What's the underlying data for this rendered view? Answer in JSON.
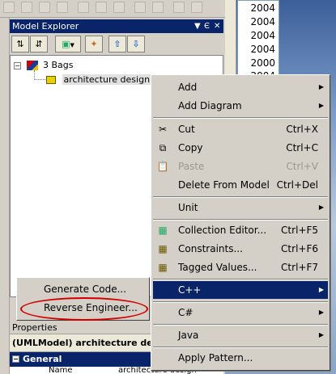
{
  "explorer": {
    "title": "Model Explorer",
    "tree": {
      "root": "3 Bags",
      "child": "architecture design",
      "expand_symbol": "−"
    }
  },
  "years": [
    "2004",
    "2004",
    "2004",
    "2004",
    "2000",
    "2004"
  ],
  "context_menu": {
    "items": [
      {
        "label": "Add",
        "shortcut": "",
        "submenu": true,
        "icon": "",
        "disabled": false,
        "highlighted": false
      },
      {
        "label": "Add Diagram",
        "shortcut": "",
        "submenu": true,
        "icon": "",
        "disabled": false,
        "highlighted": false
      },
      {
        "label": "Cut",
        "shortcut": "Ctrl+X",
        "submenu": false,
        "icon": "scissors-icon",
        "disabled": false,
        "highlighted": false
      },
      {
        "label": "Copy",
        "shortcut": "Ctrl+C",
        "submenu": false,
        "icon": "copy-icon",
        "disabled": false,
        "highlighted": false
      },
      {
        "label": "Paste",
        "shortcut": "Ctrl+V",
        "submenu": false,
        "icon": "paste-icon",
        "disabled": true,
        "highlighted": false
      },
      {
        "label": "Delete From Model",
        "shortcut": "Ctrl+Del",
        "submenu": false,
        "icon": "",
        "disabled": false,
        "highlighted": false
      },
      {
        "label": "Unit",
        "shortcut": "",
        "submenu": true,
        "icon": "",
        "disabled": false,
        "highlighted": false
      },
      {
        "label": "Collection Editor...",
        "shortcut": "Ctrl+F5",
        "submenu": false,
        "icon": "collection-editor-icon",
        "disabled": false,
        "highlighted": false
      },
      {
        "label": "Constraints...",
        "shortcut": "Ctrl+F6",
        "submenu": false,
        "icon": "constraints-icon",
        "disabled": false,
        "highlighted": false
      },
      {
        "label": "Tagged Values...",
        "shortcut": "Ctrl+F7",
        "submenu": false,
        "icon": "tagged-values-icon",
        "disabled": false,
        "highlighted": false
      },
      {
        "label": "C++",
        "shortcut": "",
        "submenu": true,
        "icon": "",
        "disabled": false,
        "highlighted": true
      },
      {
        "label": "C#",
        "shortcut": "",
        "submenu": true,
        "icon": "",
        "disabled": false,
        "highlighted": false
      },
      {
        "label": "Java",
        "shortcut": "",
        "submenu": true,
        "icon": "",
        "disabled": false,
        "highlighted": false
      },
      {
        "label": "Apply Pattern...",
        "shortcut": "",
        "submenu": false,
        "icon": "",
        "disabled": false,
        "highlighted": false
      }
    ]
  },
  "cpp_submenu": {
    "items": [
      "Generate Code...",
      "Reverse Engineer..."
    ]
  },
  "properties": {
    "title": "Properties",
    "header": "(UMLModel) architecture desig",
    "section": "General",
    "row_name": "Name",
    "row_value": "architecture design"
  },
  "colors": {
    "selection": "#0a246a",
    "highlight_oval": "#d40000",
    "menu_bg": "#d4d0c8"
  }
}
